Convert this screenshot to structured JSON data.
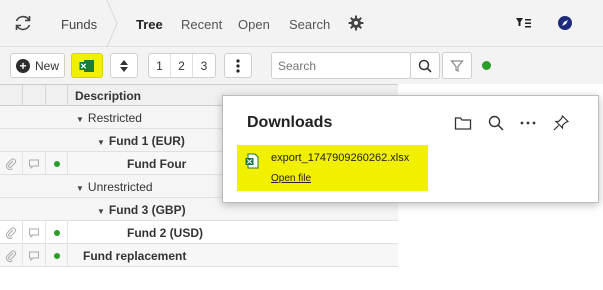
{
  "topnav": {
    "funds_label": "Funds",
    "tabs": [
      {
        "label": "Tree",
        "active": true
      },
      {
        "label": "Recent",
        "active": false
      },
      {
        "label": "Open",
        "active": false
      },
      {
        "label": "Search",
        "active": false
      }
    ],
    "icons": [
      "refresh-icon",
      "gear-icon",
      "filter-list-icon",
      "compass-icon"
    ]
  },
  "toolbar": {
    "new_label": "New",
    "pages": [
      "1",
      "2",
      "3"
    ],
    "search_placeholder": "Search",
    "status_color": "#2a9d2a",
    "export_highlight": "#f0f000"
  },
  "grid": {
    "header": {
      "description": "Description"
    },
    "rows": [
      {
        "type": "group",
        "label": "Restricted"
      },
      {
        "type": "group",
        "label": "Fund 1 (EUR)"
      },
      {
        "type": "item",
        "label": "Fund Four"
      },
      {
        "type": "group",
        "label": "Unrestricted"
      },
      {
        "type": "group",
        "label": "Fund 3 (GBP)"
      },
      {
        "type": "item",
        "label": "Fund 2 (USD)"
      },
      {
        "type": "item",
        "label": "Fund replacement"
      }
    ]
  },
  "downloads": {
    "title": "Downloads",
    "file_name": "export_1747909260262.xlsx",
    "open_label": "Open file",
    "highlight": "#f0f000"
  }
}
